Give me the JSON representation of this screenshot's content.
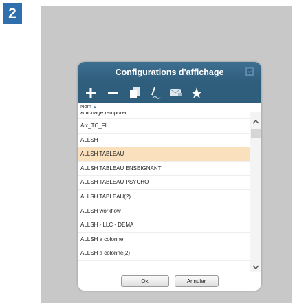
{
  "step_badge": "2",
  "dialog": {
    "title": "Configurations d'affichage",
    "close_icon": "⊠"
  },
  "toolbar": {
    "icons": [
      "plus-icon",
      "minus-icon",
      "duplicate-icon",
      "rename-pen-icon",
      "mail-icon",
      "star-icon"
    ]
  },
  "list": {
    "column_header": "Nom",
    "sort_indicator": "▲",
    "rows": [
      "Affichage temporel",
      "Aix_TC_FI",
      "ALLSH",
      "ALLSH TABLEAU",
      "ALLSH TABLEAU ENSEIGNANT",
      "ALLSH TABLEAU PSYCHO",
      "ALLSH TABLEAU(2)",
      "ALLSH workflow",
      "ALLSH - LLC - DEMA",
      "ALLSH a colonne",
      "ALLSH a colonne(2)"
    ],
    "selected_row": "ALLSH TABLEAU"
  },
  "scrollbar": {
    "up": "^",
    "down": "v"
  },
  "buttons": {
    "ok": "Ok",
    "cancel": "Annuler"
  },
  "colors": {
    "accent": "#2f5d7c",
    "selection": "#fbe0bd",
    "badge": "#2f6fae"
  }
}
